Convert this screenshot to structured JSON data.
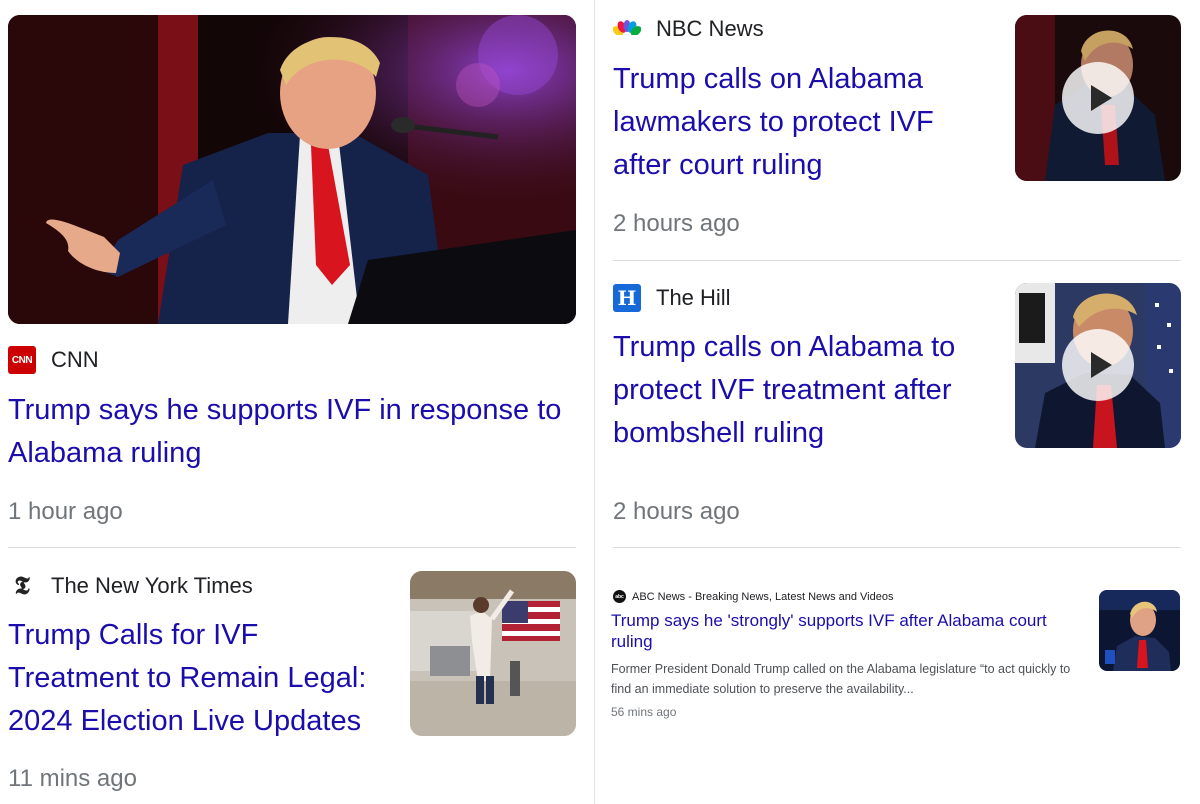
{
  "colors": {
    "link": "#1a0dab",
    "text": "#202124",
    "meta": "#70757a",
    "cnn_red": "#cc0000",
    "hill_blue": "#1769d8"
  },
  "articles": [
    {
      "source": "CNN",
      "logo_icon": "cnn-logo-icon",
      "title": "Trump says he supports IVF in response to Alabama ruling",
      "time": "1 hour ago"
    },
    {
      "source": "The New York Times",
      "logo_icon": "nyt-logo-icon",
      "title": "Trump Calls for IVF Treatment to Remain Legal: 2024 Election Live Updates",
      "time": "11 mins ago"
    },
    {
      "source": "NBC News",
      "logo_icon": "nbc-peacock-icon",
      "title": "Trump calls on Alabama lawmakers to protect IVF after court ruling",
      "time": "2 hours ago",
      "has_video": true
    },
    {
      "source": "The Hill",
      "logo_icon": "the-hill-logo-icon",
      "logo_text": "H",
      "title": "Trump calls on Alabama to protect IVF treatment after bombshell ruling",
      "time": "2 hours ago",
      "has_video": true
    },
    {
      "source": "ABC News - Breaking News, Latest News and Videos",
      "logo_icon": "abc-logo-icon",
      "logo_text": "abc",
      "title": "Trump says he 'strongly' supports IVF after Alabama court ruling",
      "snippet": "Former President Donald Trump called on the Alabama legislature “to act quickly to find an immediate solution to preserve the availability...",
      "time": "56 mins ago"
    }
  ]
}
